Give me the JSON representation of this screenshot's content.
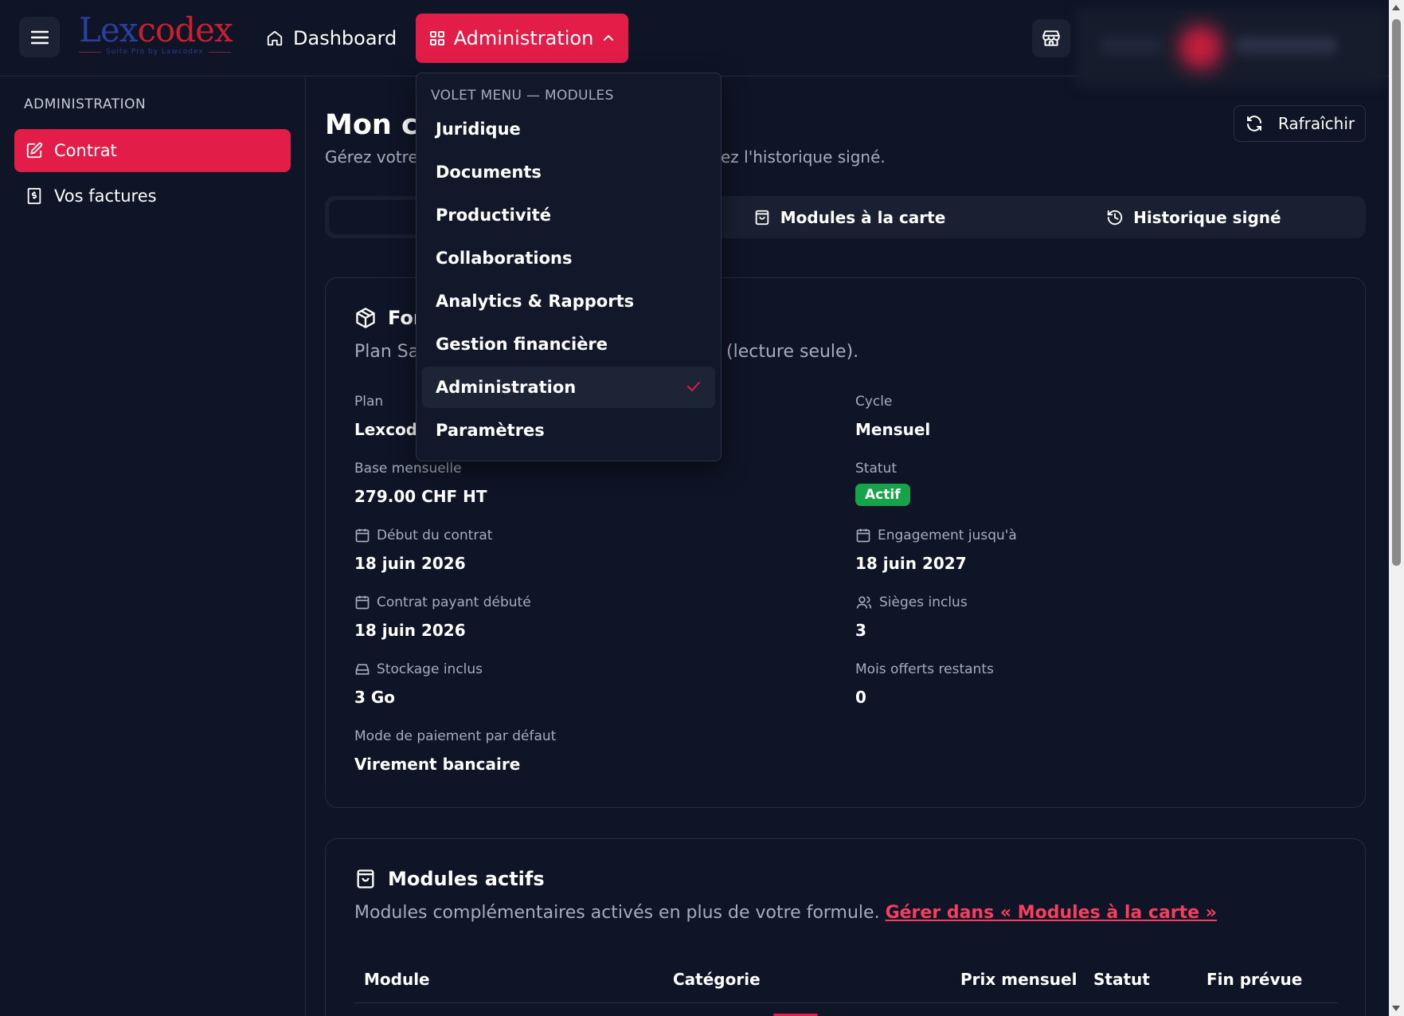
{
  "header": {
    "logo_text_a": "Lex",
    "logo_text_b": "codex",
    "logo_tagline": "Suite Pro by Lawcodex",
    "nav_dashboard": "Dashboard",
    "nav_administration": "Administration"
  },
  "sidebar": {
    "heading": "ADMINISTRATION",
    "items": [
      {
        "label": "Contrat",
        "icon": "contract-edit-icon",
        "active": true
      },
      {
        "label": "Vos factures",
        "icon": "invoice-icon",
        "active": false
      }
    ]
  },
  "page": {
    "title": "Mon co",
    "subtitle_left": "Gérez votre",
    "subtitle_right": "ez l'historique signé.",
    "refresh_label": "Rafraîchir",
    "tabs": [
      {
        "label": "",
        "selected": true
      },
      {
        "label": "Modules à la carte",
        "icon": "shopping-bag-icon"
      },
      {
        "label": "Historique signé",
        "icon": "history-icon"
      }
    ]
  },
  "formula_card": {
    "title": "For",
    "subtitle_left": "Plan Sa",
    "subtitle_right": "(lecture seule).",
    "fields": {
      "plan": {
        "label": "Plan",
        "value": "Lexcode"
      },
      "cycle": {
        "label": "Cycle",
        "value": "Mensuel"
      },
      "base": {
        "label": "Base mensuelle",
        "value": "279.00 CHF HT"
      },
      "status": {
        "label": "Statut",
        "value": "Actif"
      },
      "start": {
        "label": "Début du contrat",
        "value": "18 juin 2026"
      },
      "commitment": {
        "label": "Engagement jusqu'à",
        "value": "18 juin 2027"
      },
      "paid_start": {
        "label": "Contrat payant débuté",
        "value": "18 juin 2026"
      },
      "seats": {
        "label": "Sièges inclus",
        "value": "3"
      },
      "storage": {
        "label": "Stockage inclus",
        "value": "3 Go"
      },
      "free_months": {
        "label": "Mois offerts restants",
        "value": "0"
      },
      "payment": {
        "label": "Mode de paiement par défaut",
        "value": "Virement bancaire"
      }
    }
  },
  "modules_card": {
    "title": "Modules actifs",
    "subtitle": "Modules complémentaires activés en plus de votre formule.",
    "link": "Gérer dans « Modules à la carte »",
    "columns": [
      "Module",
      "Catégorie",
      "Prix mensuel",
      "Statut",
      "Fin prévue"
    ]
  },
  "dropdown": {
    "heading": "VOLET MENU — MODULES",
    "items": [
      {
        "label": "Juridique"
      },
      {
        "label": "Documents"
      },
      {
        "label": "Productivité"
      },
      {
        "label": "Collaborations"
      },
      {
        "label": "Analytics & Rapports"
      },
      {
        "label": "Gestion financière"
      },
      {
        "label": "Administration",
        "current": true
      },
      {
        "label": "Paramètres"
      }
    ]
  },
  "colors": {
    "background": "#0f1426",
    "accent": "#e11d48",
    "success": "#16a34a",
    "panel": "#1a2031"
  }
}
